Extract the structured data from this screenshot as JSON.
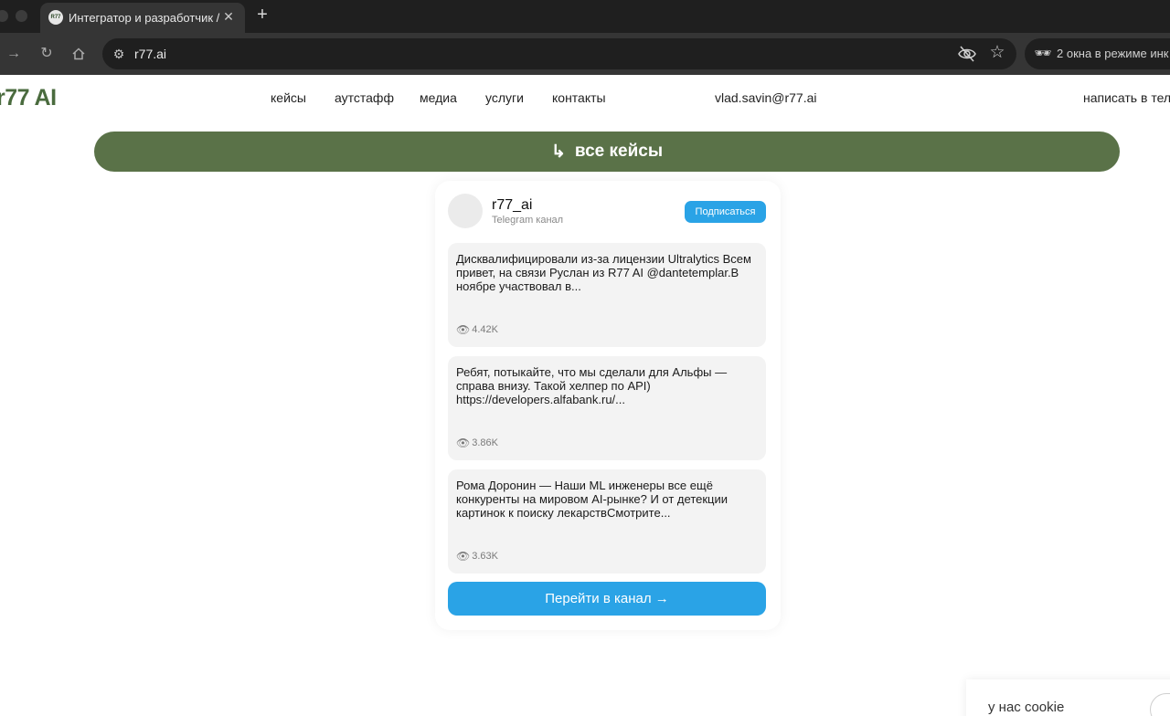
{
  "browser": {
    "tab_title": "Интегратор и разработчик /",
    "tab_favicon": "R77",
    "url": "r77.ai",
    "incognito_text": "2 окна в режиме инк"
  },
  "site": {
    "logo": "r77 AI",
    "nav": [
      "кейсы",
      "аутстафф",
      "медиа",
      "услуги",
      "контакты"
    ],
    "email": "vlad.savin@r77.ai",
    "write_link": "написать в тел",
    "cases_button": "все кейсы",
    "cases_arrow": "↳"
  },
  "widget": {
    "channel_name": "r77_ai",
    "channel_type": "Telegram канал",
    "subscribe_label": "Подписаться",
    "posts": [
      {
        "text": "Дисквалифицировали из-за лицензии Ultralytics Всем привет, на связи Руслан из R77 AI @dantetemplar.В ноябре участвовал в...",
        "views": "4.42K"
      },
      {
        "text": "Ребят, потыкайте, что мы сделали для Альфы — справа внизу. Такой хелпер по API) https://developers.alfabank.ru/...",
        "views": "3.86K"
      },
      {
        "text": "Рома Доронин — Наши ML инженеры все ещё конкуренты на мировом AI-рынке? И от детекции картинок к поиску лекарствСмотрите...",
        "views": "3.63K"
      }
    ],
    "go_label": "Перейти в канал →"
  },
  "cookie": {
    "text": "у нас cookie"
  },
  "colors": {
    "brand_green": "#5a7248",
    "telegram_blue": "#2aa3e6"
  }
}
